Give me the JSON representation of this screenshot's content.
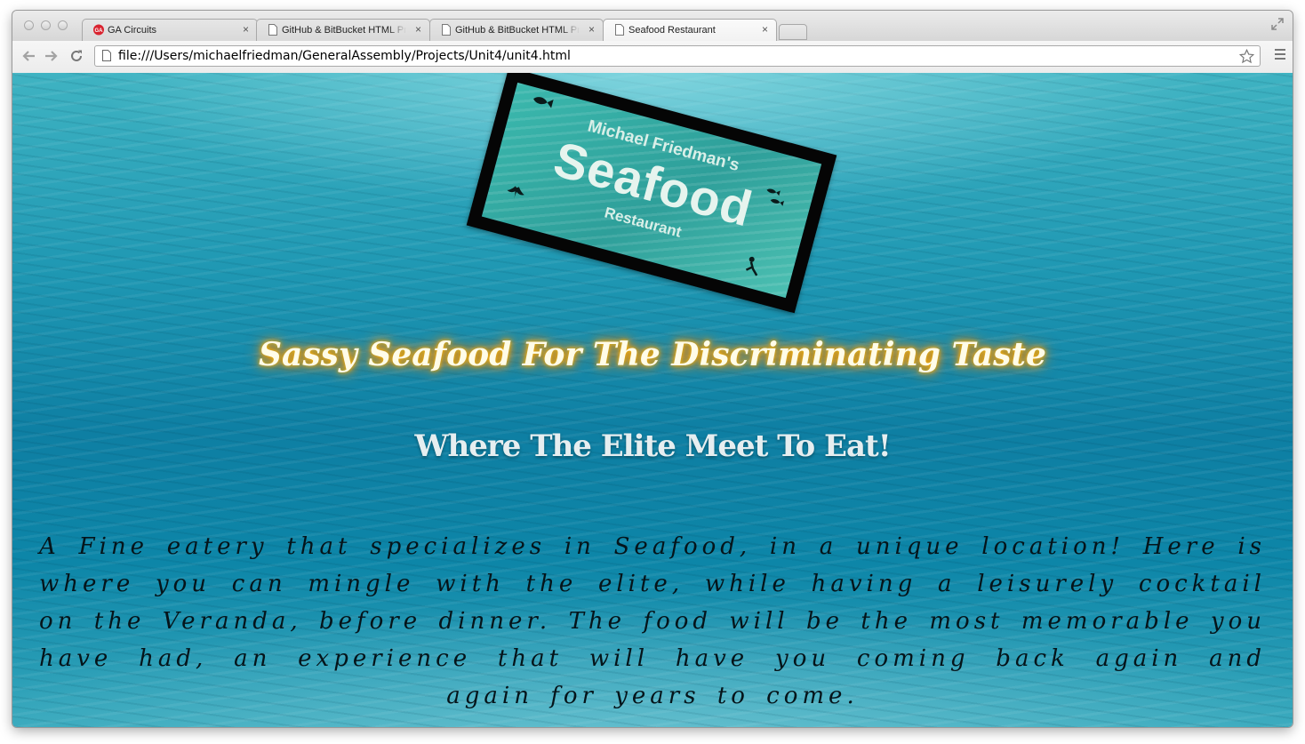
{
  "browser": {
    "tabs": [
      {
        "label": "GA Circuits",
        "icon": "ga-logo-icon",
        "active": false
      },
      {
        "label": "GitHub & BitBucket HTML Preview",
        "icon": "document-icon",
        "active": false
      },
      {
        "label": "GitHub & BitBucket HTML Preview",
        "icon": "document-icon",
        "active": false
      },
      {
        "label": "Seafood Restaurant",
        "icon": "document-icon",
        "active": true
      }
    ],
    "close_glyph": "×",
    "url": "file:///Users/michaelfriedman/GeneralAssembly/Projects/Unit4/unit4.html"
  },
  "page": {
    "sign": {
      "owner": "Michael Friedman's",
      "name": "Seafood",
      "type": "Restaurant"
    },
    "tagline": "Sassy Seafood For The Discriminating Taste",
    "subtitle": "Where The Elite Meet To Eat!",
    "description": "A Fine eatery that specializes in Seafood, in a unique location! Here is where you can mingle with the elite, while having a leisurely cocktail on the Veranda, before dinner. The food will be the most memorable you have had, an experience that will have you coming back again and again for years to come."
  },
  "colors": {
    "tagline_glow": "#ff9a00",
    "water": "#1f98b3"
  }
}
